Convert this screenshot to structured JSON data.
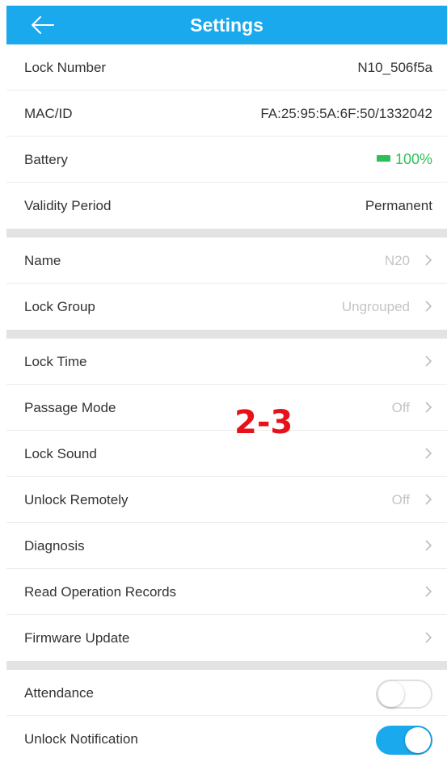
{
  "header": {
    "title": "Settings"
  },
  "info": [
    {
      "label": "Lock Number",
      "value": "N10_506f5a"
    },
    {
      "label": "MAC/ID",
      "value": "FA:25:95:5A:6F:50/1332042"
    },
    {
      "label": "Battery",
      "value": "100%"
    },
    {
      "label": "Validity Period",
      "value": "Permanent"
    }
  ],
  "general": [
    {
      "label": "Name",
      "value": "N20"
    },
    {
      "label": "Lock Group",
      "value": "Ungrouped"
    }
  ],
  "features": [
    {
      "label": "Lock Time",
      "value": ""
    },
    {
      "label": "Passage Mode",
      "value": "Off"
    },
    {
      "label": "Lock Sound",
      "value": ""
    },
    {
      "label": "Unlock Remotely",
      "value": "Off"
    },
    {
      "label": "Diagnosis",
      "value": ""
    },
    {
      "label": "Read Operation Records",
      "value": ""
    },
    {
      "label": "Firmware Update",
      "value": ""
    }
  ],
  "toggles": [
    {
      "label": "Attendance",
      "state": "off"
    },
    {
      "label": "Unlock Notification",
      "state": "on"
    }
  ],
  "overlay_text": "2-3",
  "colors": {
    "header": "#1aa9ec",
    "battery": "#2cbf57",
    "overlay": "#e8111a"
  }
}
